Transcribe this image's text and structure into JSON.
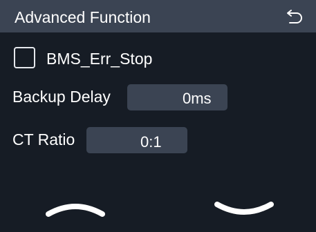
{
  "header": {
    "title": "Advanced Function",
    "back_icon": "undo-arrow-icon"
  },
  "settings": {
    "bms_err_stop": {
      "label": "BMS_Err_Stop",
      "checked": false
    },
    "backup_delay": {
      "label": "Backup Delay",
      "value": "0ms"
    },
    "ct_ratio": {
      "label": "CT Ratio",
      "value": "0:1"
    }
  },
  "navigation": {
    "up_icon": "chevron-up-icon",
    "down_icon": "chevron-down-icon"
  },
  "colors": {
    "background": "#161c25",
    "header_bar": "#3b4453",
    "field_bg": "#3b4453",
    "text": "#ffffff"
  }
}
